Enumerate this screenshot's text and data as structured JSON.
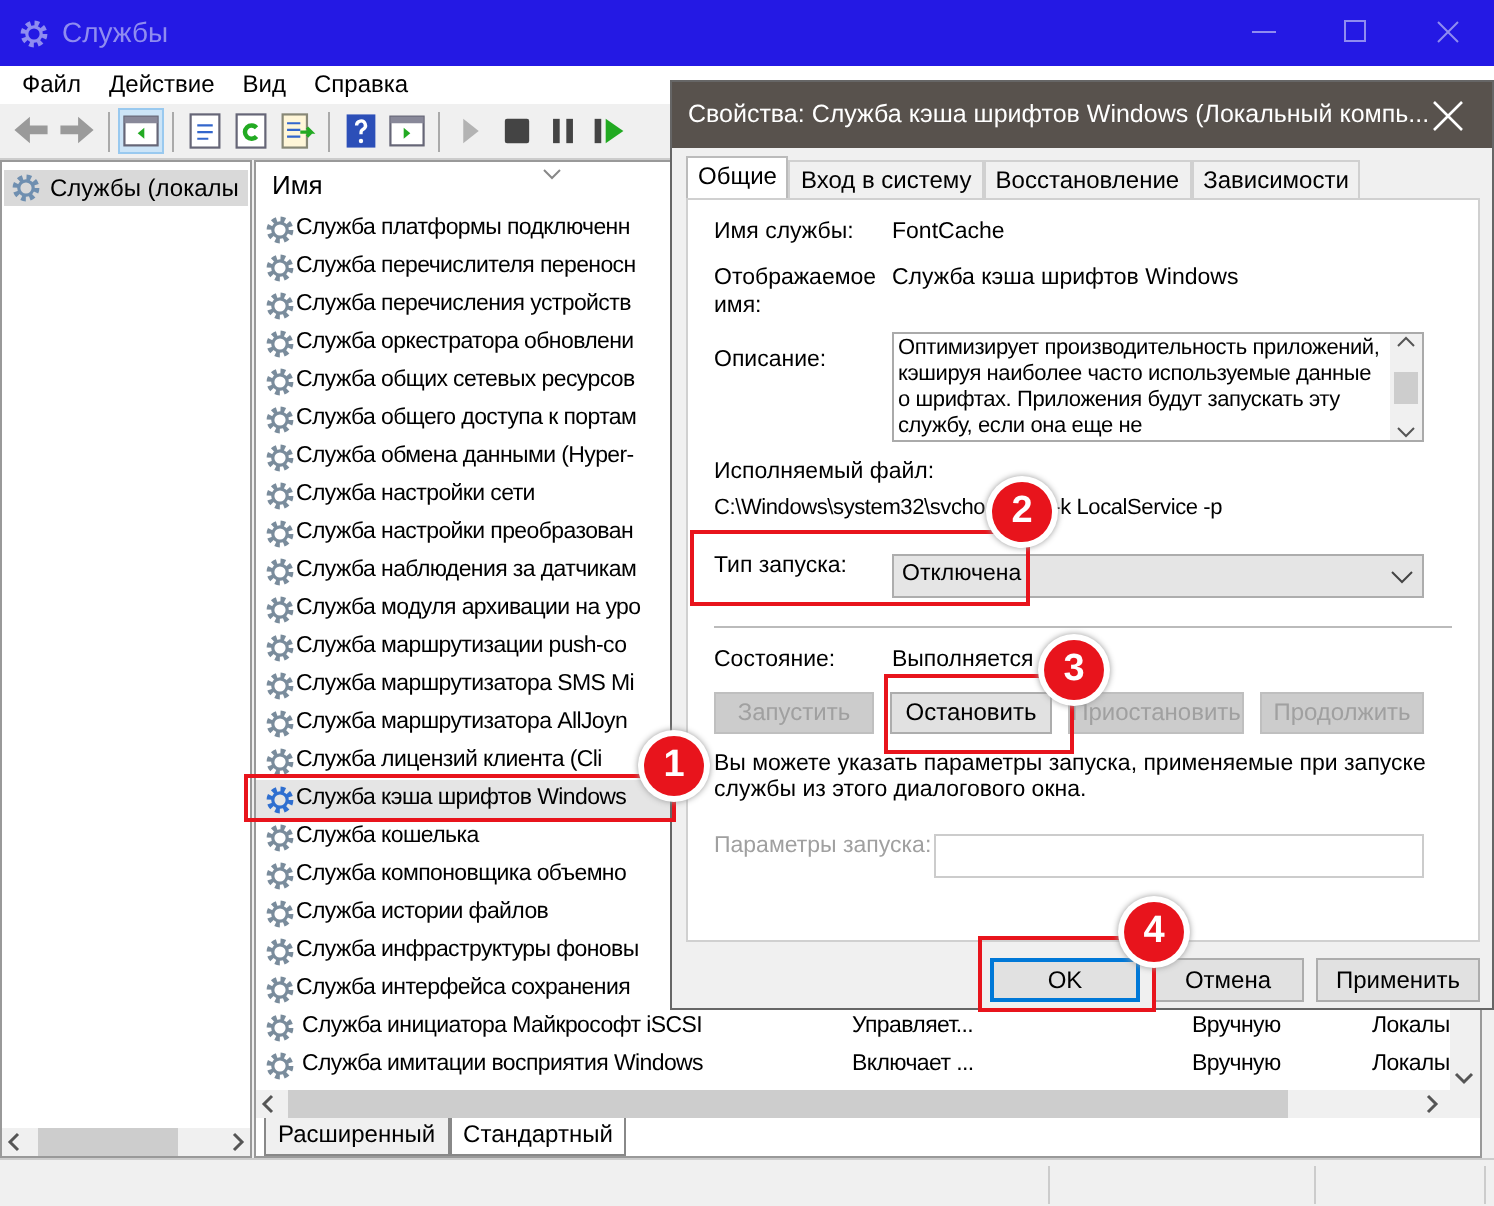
{
  "window": {
    "title": "Службы"
  },
  "menu": [
    "Файл",
    "Действие",
    "Вид",
    "Справка"
  ],
  "toolbar": [
    [
      {
        "selected": false,
        "disabled": true
      },
      {
        "selected": false,
        "disabled": true
      }
    ],
    [
      {
        "selected": true,
        "disabled": false
      }
    ],
    [
      {
        "selected": false,
        "disabled": false
      },
      {
        "selected": false,
        "disabled": false
      },
      {
        "selected": false,
        "disabled": false
      }
    ],
    [
      {
        "selected": false,
        "disabled": false
      },
      {
        "selected": false,
        "disabled": false
      }
    ],
    [
      {
        "selected": false,
        "disabled": true
      },
      {
        "selected": false,
        "disabled": false
      },
      {
        "selected": false,
        "disabled": false
      },
      {
        "selected": false,
        "disabled": false
      }
    ]
  ],
  "tree": {
    "items": [
      {
        "label": "Службы (локалы",
        "selected": true
      }
    ]
  },
  "list": {
    "columns": [
      "Имя"
    ],
    "rows": [
      {
        "name": "Служба платформы подключенн",
        "selected": false
      },
      {
        "name": "Служба перечислителя переносн",
        "selected": false
      },
      {
        "name": "Служба перечисления устройств",
        "selected": false
      },
      {
        "name": "Служба оркестратора обновлени",
        "selected": false
      },
      {
        "name": "Служба общих сетевых ресурсов",
        "selected": false
      },
      {
        "name": "Служба общего доступа к портам",
        "selected": false
      },
      {
        "name": "Служба обмена данными (Hyper-",
        "selected": false
      },
      {
        "name": "Служба настройки сети",
        "selected": false
      },
      {
        "name": "Служба настройки преобразован",
        "selected": false
      },
      {
        "name": "Служба наблюдения за датчикам",
        "selected": false
      },
      {
        "name": "Служба модуля архивации на уро",
        "selected": false
      },
      {
        "name": "Служба маршрутизации push-со",
        "selected": false
      },
      {
        "name": "Служба маршрутизатора SMS Mi",
        "selected": false
      },
      {
        "name": "Служба маршрутизатора AllJoyn",
        "selected": false
      },
      {
        "name": "Служба лицензий клиента (Cli",
        "selected": false
      },
      {
        "name": "Служба кэша шрифтов Windows",
        "selected": true
      },
      {
        "name": "Служба кошелька",
        "selected": false
      },
      {
        "name": "Служба компоновщика объемно",
        "selected": false
      },
      {
        "name": "Служба истории файлов",
        "selected": false
      },
      {
        "name": "Служба инфраструктуры фоновы",
        "selected": false
      },
      {
        "name": "Служба интерфейса сохранения",
        "selected": false
      },
      {
        "name": "Служба инициатора Майкрософт iSCSI",
        "description": "Управляет...",
        "startup": "Вручную",
        "logon": "Локалы",
        "selected": false
      },
      {
        "name": "Служба имитации восприятия Windows",
        "description": "Включает ...",
        "startup": "Вручную",
        "logon": "Локалы",
        "selected": false
      }
    ]
  },
  "bottom_tabs": [
    {
      "label": "Расширенный",
      "selected": false
    },
    {
      "label": "Стандартный",
      "selected": true
    }
  ],
  "dialog": {
    "title": "Свойства: Служба кэша шрифтов Windows (Локальный компь...",
    "tabs": [
      {
        "label": "Общие",
        "selected": true
      },
      {
        "label": "Вход в систему",
        "selected": false
      },
      {
        "label": "Восстановление",
        "selected": false
      },
      {
        "label": "Зависимости",
        "selected": false
      }
    ],
    "service_name": {
      "label": "Имя службы:",
      "value": "FontCache"
    },
    "display_name": {
      "label": "Отображаемое имя:",
      "value": "Служба кэша шрифтов Windows"
    },
    "description": {
      "label": "Описание:",
      "value": "Оптимизирует производительность приложений, кэшируя наиболее часто используемые данные о шрифтах. Приложения будут запускать эту службу, если она еще не"
    },
    "executable": {
      "label": "Исполняемый файл:",
      "path_parts": [
        "C:\\Windows\\system32\\svcho",
        "-k LocalService -p"
      ]
    },
    "startup_type": {
      "label": "Тип запуска:",
      "value": "Отключена"
    },
    "status": {
      "label": "Состояние:",
      "value": "Выполняется"
    },
    "service_buttons": [
      {
        "label": "Запустить",
        "disabled": true
      },
      {
        "label": "Остановить",
        "disabled": false
      },
      {
        "label": "Приостановить",
        "disabled": true
      },
      {
        "label": "Продолжить",
        "disabled": true
      }
    ],
    "note": "Вы можете указать параметры запуска, применяемые при запуске службы из этого диалогового окна.",
    "start_params": {
      "label": "Параметры запуска:",
      "disabled": true
    },
    "buttons": [
      {
        "label": "OK",
        "default": true
      },
      {
        "label": "Отмена",
        "default": false
      },
      {
        "label": "Применить",
        "default": false
      }
    ]
  },
  "callouts": [
    {
      "number": "1"
    },
    {
      "number": "2"
    },
    {
      "number": "3"
    },
    {
      "number": "4"
    }
  ]
}
